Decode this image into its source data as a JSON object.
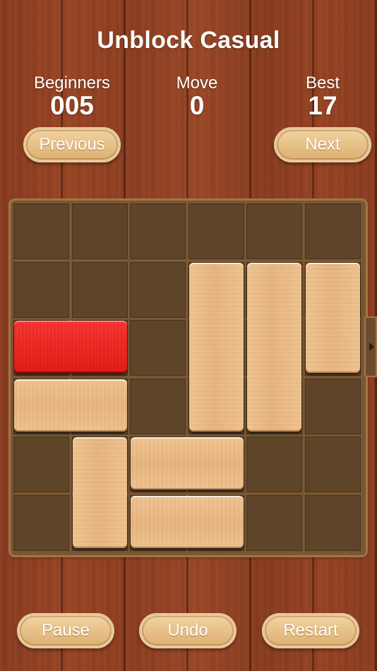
{
  "header": {
    "title": "Unblock Casual"
  },
  "stats": {
    "level_label": "Beginners",
    "level_value": "005",
    "move_label": "Move",
    "move_value": "0",
    "best_label": "Best",
    "best_value": "17"
  },
  "nav": {
    "previous_label": "Previous",
    "next_label": "Next"
  },
  "controls": {
    "pause_label": "Pause",
    "undo_label": "Undo",
    "restart_label": "Restart"
  },
  "board": {
    "rows": 6,
    "cols": 6,
    "exit_row": 2,
    "blocks": [
      {
        "id": "target",
        "row": 2,
        "col": 0,
        "length": 2,
        "orientation": "horizontal",
        "color": "#ea1f1a"
      },
      {
        "id": "b1",
        "row": 1,
        "col": 3,
        "length": 3,
        "orientation": "vertical"
      },
      {
        "id": "b2",
        "row": 1,
        "col": 4,
        "length": 3,
        "orientation": "vertical"
      },
      {
        "id": "b3",
        "row": 1,
        "col": 5,
        "length": 2,
        "orientation": "vertical"
      },
      {
        "id": "b4",
        "row": 3,
        "col": 0,
        "length": 2,
        "orientation": "horizontal"
      },
      {
        "id": "b5",
        "row": 4,
        "col": 1,
        "length": 2,
        "orientation": "vertical"
      },
      {
        "id": "b6",
        "row": 4,
        "col": 2,
        "length": 2,
        "orientation": "horizontal"
      },
      {
        "id": "b7",
        "row": 5,
        "col": 2,
        "length": 2,
        "orientation": "horizontal"
      }
    ]
  },
  "colors": {
    "wood_background": "#8e3f20",
    "block_wood": "#ecbd89",
    "target_block": "#ea1f1a"
  }
}
